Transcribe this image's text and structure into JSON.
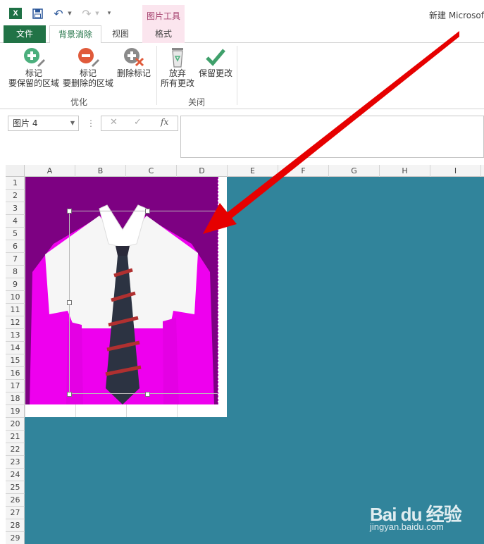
{
  "titlebar": {
    "app_icon_letter": "X",
    "contextual_title": "图片工具",
    "window_title": "新建 Microsof"
  },
  "tabs": {
    "file": "文件",
    "background_removal": "背景消除",
    "view": "视图",
    "format": "格式"
  },
  "ribbon": {
    "mark_keep": {
      "line1": "标记",
      "line2": "要保留的区域",
      "icon": "mark-keep-icon"
    },
    "mark_remove": {
      "line1": "标记",
      "line2": "要删除的区域",
      "icon": "mark-remove-icon"
    },
    "delete_mark": {
      "line1": "删除标记",
      "icon": "delete-mark-icon"
    },
    "discard": {
      "line1": "放弃",
      "line2": "所有更改",
      "icon": "recycle-bin-icon"
    },
    "keep": {
      "line1": "保留更改",
      "icon": "checkmark-icon"
    },
    "groups": {
      "optimize": "优化",
      "close": "关闭"
    }
  },
  "formula_bar": {
    "name_box": "图片 4",
    "fx": "fx",
    "formula": ""
  },
  "grid": {
    "columns": [
      "A",
      "B",
      "C",
      "D",
      "E",
      "F",
      "G",
      "H",
      "I"
    ],
    "rows": [
      "1",
      "2",
      "3",
      "4",
      "5",
      "6",
      "7",
      "8",
      "9",
      "10",
      "11",
      "12",
      "13",
      "14",
      "15",
      "16",
      "17",
      "18",
      "19",
      "20",
      "21",
      "22",
      "23",
      "24",
      "25",
      "26",
      "27",
      "28",
      "29"
    ]
  },
  "colors": {
    "excel_green": "#217346",
    "removed_area_magenta": "#ee00ee",
    "teal_overlay": "#31849b",
    "arrow_red": "#e60000"
  },
  "watermark": {
    "logo": "Bai du 经验",
    "url": "jingyan.baidu.com"
  }
}
